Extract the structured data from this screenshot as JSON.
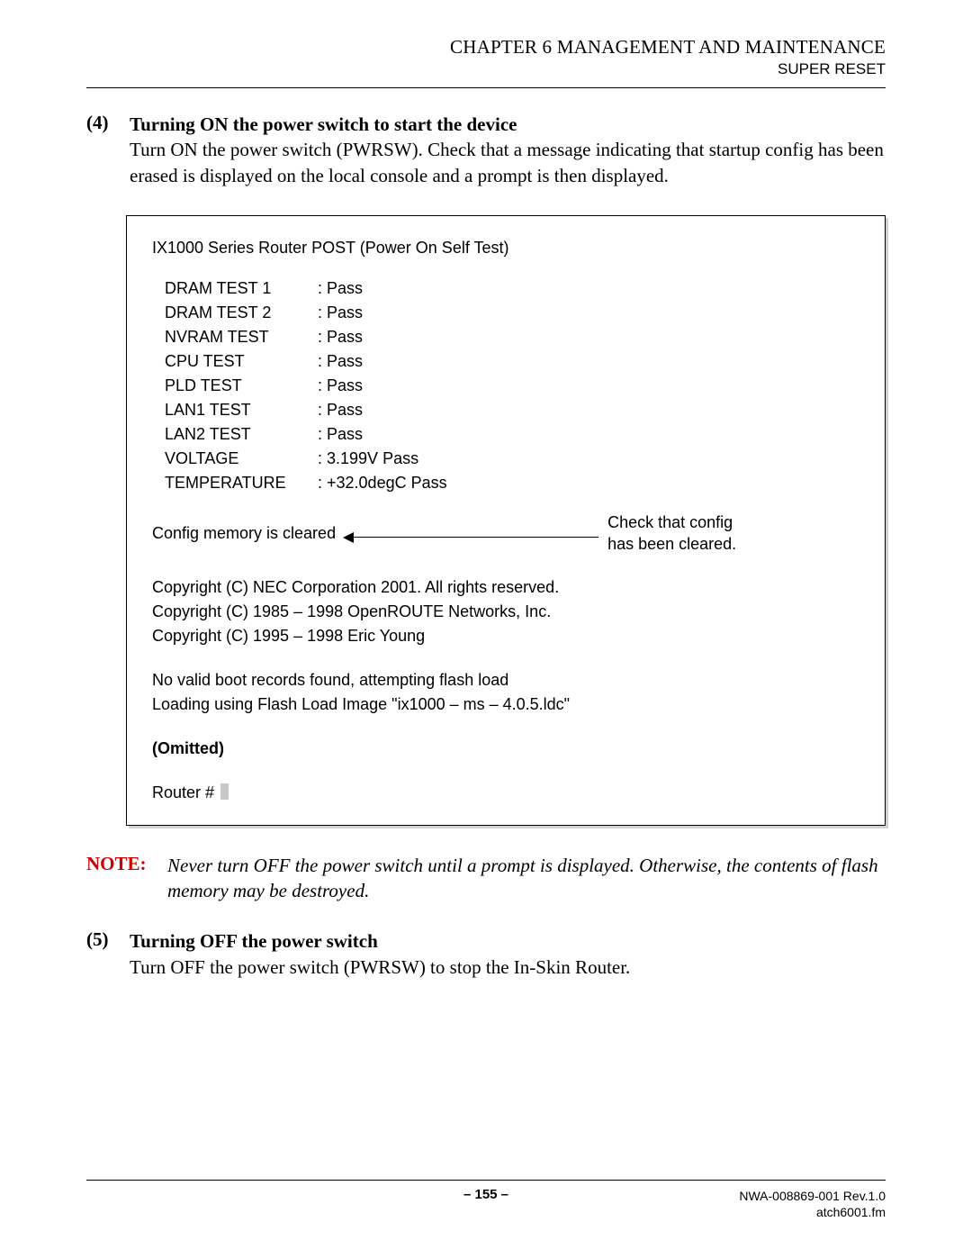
{
  "header": {
    "chapter": "CHAPTER 6   MANAGEMENT AND MAINTENANCE",
    "section": "SUPER RESET"
  },
  "step4": {
    "number": "(4)",
    "title": "Turning ON the power switch to start the device",
    "body": "Turn ON the power switch (PWRSW). Check that a message indicating that startup config has been erased is displayed on the local console and a prompt is then displayed."
  },
  "console": {
    "title": "IX1000 Series Router POST (Power On Self Test)",
    "tests": [
      {
        "name": "DRAM TEST 1",
        "result": "Pass"
      },
      {
        "name": "DRAM TEST 2",
        "result": "Pass"
      },
      {
        "name": "NVRAM TEST",
        "result": "Pass"
      },
      {
        "name": "CPU TEST",
        "result": "Pass"
      },
      {
        "name": "PLD TEST",
        "result": "Pass"
      },
      {
        "name": "LAN1 TEST",
        "result": "Pass"
      },
      {
        "name": "LAN2 TEST",
        "result": "Pass"
      },
      {
        "name": "VOLTAGE",
        "result": "3.199V Pass"
      },
      {
        "name": "TEMPERATURE",
        "result": "+32.0degC Pass"
      }
    ],
    "config_cleared": "Config memory is cleared",
    "check_note_l1": "Check that config",
    "check_note_l2": "has been cleared.",
    "copyright": [
      "Copyright (C) NEC Corporation 2001. All rights reserved.",
      "Copyright (C) 1985 – 1998 OpenROUTE Networks, Inc.",
      "Copyright (C) 1995 – 1998 Eric Young"
    ],
    "boot": [
      "No valid boot records found, attempting flash load",
      "Loading using Flash Load Image \"ix1000 – ms – 4.0.5.ldc\""
    ],
    "omitted": "(Omitted)",
    "prompt": "Router # "
  },
  "note": {
    "label": "NOTE:",
    "body": "Never turn OFF the power switch until a prompt is displayed. Otherwise, the contents of flash memory may be destroyed."
  },
  "step5": {
    "number": "(5)",
    "title": "Turning OFF the power switch",
    "body": "Turn OFF the power switch (PWRSW) to stop the In-Skin Router."
  },
  "footer": {
    "page": "– 155 –",
    "doc": "NWA-008869-001 Rev.1.0",
    "file": "atch6001.fm"
  }
}
